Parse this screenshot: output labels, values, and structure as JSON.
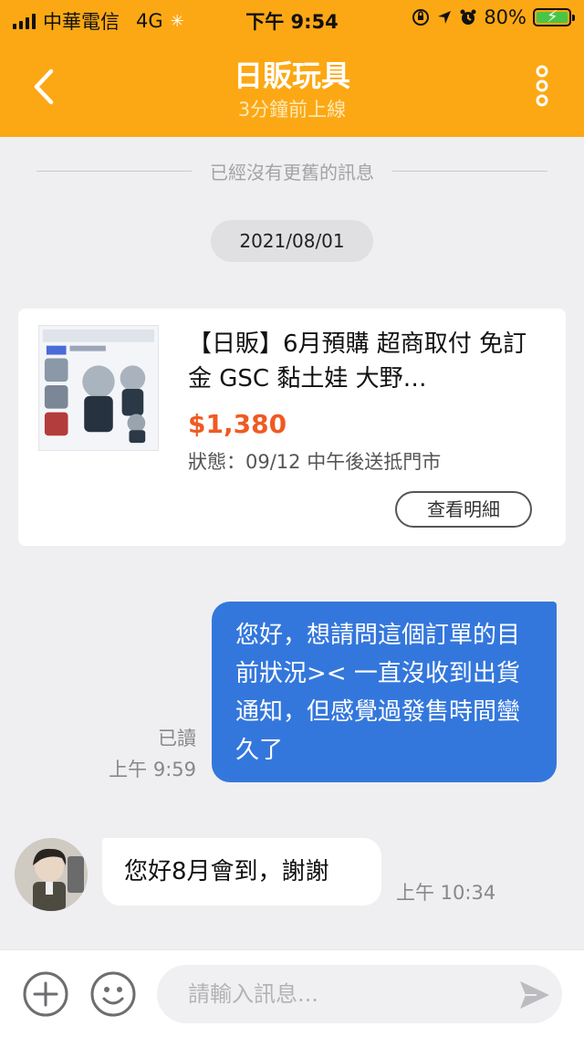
{
  "status_bar": {
    "carrier": "中華電信",
    "network": "4G",
    "time": "下午 9:54",
    "battery": "80%"
  },
  "header": {
    "title": "日販玩具",
    "subtitle": "3分鐘前上線"
  },
  "chat": {
    "no_more_messages": "已經沒有更舊的訊息",
    "date": "2021/08/01"
  },
  "order_card": {
    "title": "【日販】6月預購 超商取付 免訂金 GSC 黏土娃 大野…",
    "price": "$1,380",
    "status": "狀態：09/12 中午後送抵門市",
    "detail_button": "查看明細"
  },
  "messages": [
    {
      "direction": "outgoing",
      "text": "您好，想請問這個訂單的目前狀況>< 一直沒收到出貨通知，但感覺過發售時間蠻久了",
      "read_label": "已讀",
      "time": "上午 9:59"
    },
    {
      "direction": "incoming",
      "text": "您好8月會到，謝謝",
      "time": "上午 10:34"
    }
  ],
  "input_bar": {
    "placeholder": "請輸入訊息..."
  },
  "colors": {
    "brand": "#fca814",
    "outgoing_bubble": "#3477dc",
    "price": "#f05a22",
    "background": "#efeff1"
  },
  "icons": {
    "back": "chevron-left-icon",
    "more": "more-vertical-icon",
    "plus": "plus-circle-icon",
    "emoji": "smiley-icon",
    "send": "send-icon"
  }
}
